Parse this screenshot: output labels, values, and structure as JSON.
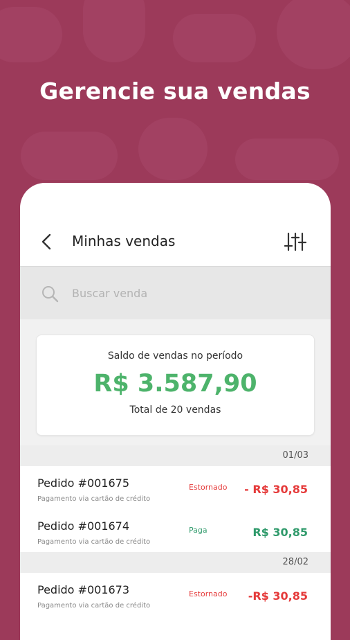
{
  "headline": "Gerencie sua vendas",
  "app": {
    "title": "Minhas vendas",
    "search_placeholder": "Buscar venda",
    "icons": {
      "back": "back-arrow-icon",
      "filter": "filter-sliders-icon",
      "search": "search-icon"
    }
  },
  "summary": {
    "label": "Saldo de vendas no período",
    "amount": "R$ 3.587,90",
    "count": "Total de 20 vendas"
  },
  "groups": [
    {
      "date": "01/03",
      "orders": [
        {
          "id": "Pedido  #001675",
          "sub": "Pagamento via cartão de crédito",
          "status": "Estornado",
          "value": "- R$ 30,85"
        },
        {
          "id": "Pedido  #001674",
          "sub": "Pagamento via cartão de crédito",
          "status": "Paga",
          "value": "R$ 30,85"
        }
      ]
    },
    {
      "date": "28/02",
      "orders": [
        {
          "id": "Pedido  #001673",
          "sub": "Pagamento via cartão de crédito",
          "status": "Estornado",
          "value": "-R$ 30,85"
        }
      ]
    }
  ],
  "colors": {
    "background": "#9c3a5a",
    "positive": "#4db36b",
    "negative": "#e53a3a"
  }
}
